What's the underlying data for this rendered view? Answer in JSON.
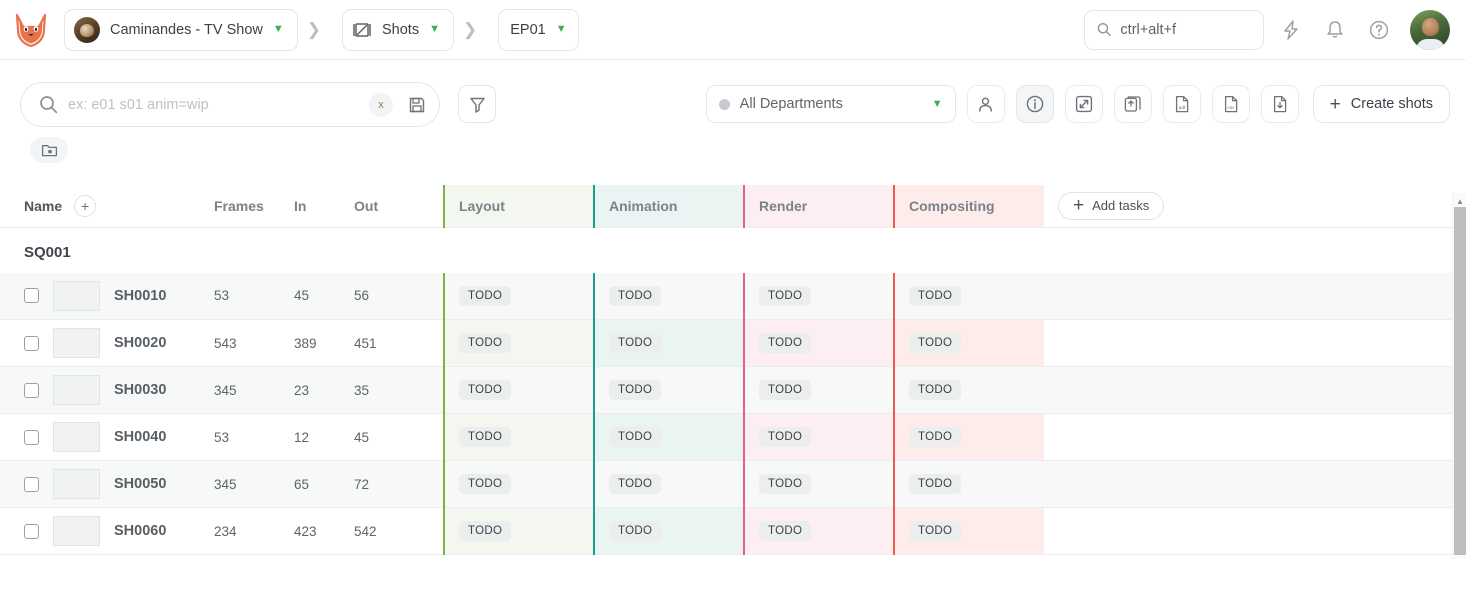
{
  "header": {
    "logo_name": "kitsu-fox-logo",
    "breadcrumbs": [
      {
        "label": "Caminandes - TV Show",
        "icon": "project-thumbnail",
        "has_chevron": true
      },
      {
        "label": "Shots",
        "icon": "film-clapboard-icon",
        "has_chevron": true
      },
      {
        "label": "EP01",
        "icon": "",
        "has_chevron": true
      }
    ],
    "search": {
      "value": "ctrl+alt+f",
      "placeholder": "ctrl+alt+f",
      "icon": "search-icon"
    },
    "actions": [
      {
        "name": "lightning-icon",
        "label": ""
      },
      {
        "name": "bell-icon",
        "label": ""
      },
      {
        "name": "help-icon",
        "label": ""
      }
    ],
    "avatar_name": "user-avatar"
  },
  "toolbar": {
    "search": {
      "placeholder": "ex: e01 s01 anim=wip",
      "value": "",
      "clear_label": "x",
      "save_icon": "floppy-save-icon"
    },
    "filter_button": "funnel-filter-icon",
    "folder_button": "folder-settings-icon",
    "department_select": {
      "value": "All Departments",
      "dot_color": "#c6cace"
    },
    "buttons": [
      {
        "name": "person-filter-button",
        "icon": "person-icon",
        "active": false
      },
      {
        "name": "info-toggle-button",
        "icon": "info-circle-icon",
        "active": true
      },
      {
        "name": "expand-button",
        "icon": "expand-arrows-icon",
        "active": false
      },
      {
        "name": "share-upload-button",
        "icon": "copy-upload-icon",
        "active": false
      },
      {
        "name": "export-pdf-button",
        "icon": "file-pdf-icon",
        "active": false
      },
      {
        "name": "export-csv-button",
        "icon": "file-csv-icon",
        "active": false
      },
      {
        "name": "import-file-button",
        "icon": "file-download-icon",
        "active": false
      }
    ],
    "create_button": {
      "label": "Create shots",
      "icon": "plus-icon"
    }
  },
  "table": {
    "columns": {
      "name": "Name",
      "add_column_icon": "plus-circle-icon",
      "frames": "Frames",
      "in": "In",
      "out": "Out",
      "add_tasks": "Add tasks"
    },
    "departments": [
      {
        "label": "Layout",
        "color": "#7cb342",
        "bg": "#f3f7ef"
      },
      {
        "label": "Animation",
        "color": "#199e8f",
        "bg": "#e9f4f3"
      },
      {
        "label": "Render",
        "color": "#e8607f",
        "bg": "#fdeef1"
      },
      {
        "label": "Compositing",
        "color": "#ea5b4a",
        "bg": "#fdecea"
      }
    ],
    "sequence": "SQ001",
    "rows": [
      {
        "name": "SH0010",
        "frames": "53",
        "in": "45",
        "out": "56",
        "tasks": [
          "TODO",
          "TODO",
          "TODO",
          "TODO"
        ]
      },
      {
        "name": "SH0020",
        "frames": "543",
        "in": "389",
        "out": "451",
        "tasks": [
          "TODO",
          "TODO",
          "TODO",
          "TODO"
        ]
      },
      {
        "name": "SH0030",
        "frames": "345",
        "in": "23",
        "out": "35",
        "tasks": [
          "TODO",
          "TODO",
          "TODO",
          "TODO"
        ]
      },
      {
        "name": "SH0040",
        "frames": "53",
        "in": "12",
        "out": "45",
        "tasks": [
          "TODO",
          "TODO",
          "TODO",
          "TODO"
        ]
      },
      {
        "name": "SH0050",
        "frames": "345",
        "in": "65",
        "out": "72",
        "tasks": [
          "TODO",
          "TODO",
          "TODO",
          "TODO"
        ]
      },
      {
        "name": "SH0060",
        "frames": "234",
        "in": "423",
        "out": "542",
        "tasks": [
          "TODO",
          "TODO",
          "TODO",
          "TODO"
        ]
      }
    ]
  }
}
